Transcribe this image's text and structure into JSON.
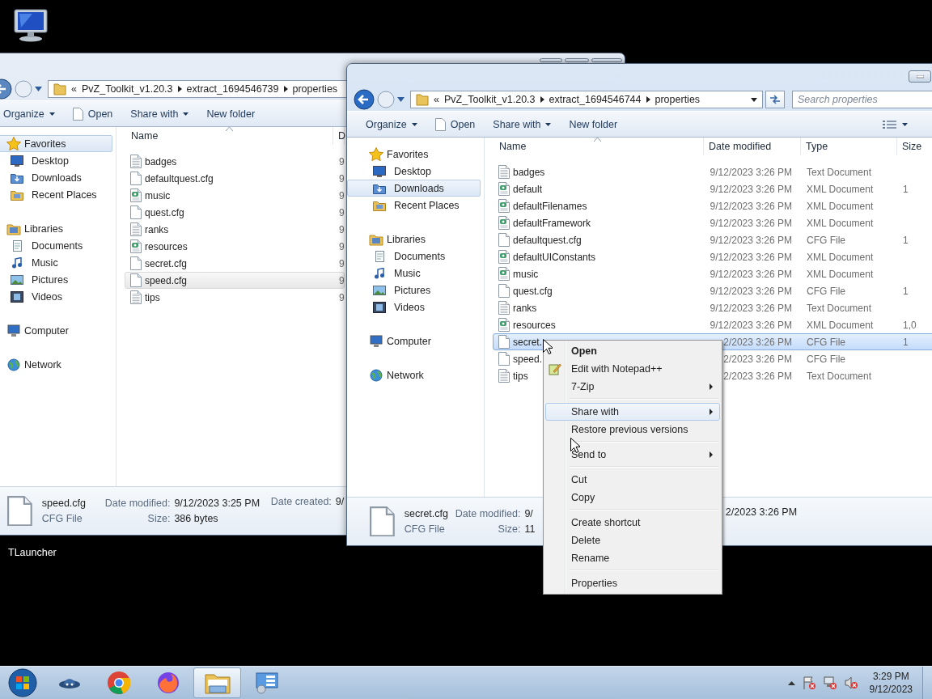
{
  "desktop_icons": [
    {
      "label": "TLauncher"
    }
  ],
  "windows": [
    {
      "active": false,
      "address": {
        "overflow": "«",
        "parts": [
          "PvZ_Toolkit_v1.20.3",
          "extract_1694546739",
          "properties"
        ]
      },
      "toolbar": [
        {
          "label": "Organize",
          "kind": "menu"
        },
        {
          "label": "Open",
          "kind": "open"
        },
        {
          "label": "Share with",
          "kind": "menu"
        },
        {
          "label": "New folder",
          "kind": "plain"
        }
      ],
      "nav": [
        {
          "label": "Favorites",
          "selected": true,
          "children": [
            {
              "label": "Desktop",
              "selected": false
            },
            {
              "label": "Downloads",
              "selected": false
            },
            {
              "label": "Recent Places",
              "selected": false
            }
          ]
        },
        {
          "label": "Libraries",
          "selected": false,
          "children": [
            {
              "label": "Documents",
              "selected": false
            },
            {
              "label": "Music",
              "selected": false
            },
            {
              "label": "Pictures",
              "selected": false
            },
            {
              "label": "Videos",
              "selected": false
            }
          ]
        },
        {
          "label": "Computer",
          "selected": false
        },
        {
          "label": "Network",
          "selected": false
        }
      ],
      "columns": [
        "Name",
        "D"
      ],
      "files": [
        {
          "name": "badges",
          "kind": "text",
          "date": "9",
          "selected": false
        },
        {
          "name": "defaultquest.cfg",
          "kind": "blank",
          "date": "9",
          "selected": false
        },
        {
          "name": "music",
          "kind": "xml",
          "date": "9",
          "selected": false
        },
        {
          "name": "quest.cfg",
          "kind": "blank",
          "date": "9",
          "selected": false
        },
        {
          "name": "ranks",
          "kind": "text",
          "date": "9",
          "selected": false
        },
        {
          "name": "resources",
          "kind": "xml",
          "date": "9",
          "selected": false
        },
        {
          "name": "secret.cfg",
          "kind": "blank",
          "date": "9",
          "selected": false
        },
        {
          "name": "speed.cfg",
          "kind": "blank",
          "date": "9",
          "selected": true
        },
        {
          "name": "tips",
          "kind": "text",
          "date": "9",
          "selected": false
        }
      ],
      "details": {
        "name": "speed.cfg",
        "type": "CFG File",
        "fields": [
          {
            "label": "Date modified:",
            "value": "9/12/2023 3:25 PM"
          },
          {
            "label": "Size:",
            "value": "386 bytes"
          },
          {
            "label": "Date created:",
            "value": "9/"
          }
        ]
      }
    },
    {
      "active": true,
      "address": {
        "overflow": "«",
        "parts": [
          "PvZ_Toolkit_v1.20.3",
          "extract_1694546744",
          "properties"
        ]
      },
      "search": {
        "placeholder": "Search properties"
      },
      "toolbar": [
        {
          "label": "Organize",
          "kind": "menu"
        },
        {
          "label": "Open",
          "kind": "open"
        },
        {
          "label": "Share with",
          "kind": "menu"
        },
        {
          "label": "New folder",
          "kind": "plain"
        }
      ],
      "nav": [
        {
          "label": "Favorites",
          "selected": false,
          "children": [
            {
              "label": "Desktop",
              "selected": false
            },
            {
              "label": "Downloads",
              "selected": true
            },
            {
              "label": "Recent Places",
              "selected": false
            }
          ]
        },
        {
          "label": "Libraries",
          "selected": false,
          "children": [
            {
              "label": "Documents",
              "selected": false
            },
            {
              "label": "Music",
              "selected": false
            },
            {
              "label": "Pictures",
              "selected": false
            },
            {
              "label": "Videos",
              "selected": false
            }
          ]
        },
        {
          "label": "Computer",
          "selected": false
        },
        {
          "label": "Network",
          "selected": false
        }
      ],
      "columns": [
        "Name",
        "Date modified",
        "Type",
        "Size"
      ],
      "files": [
        {
          "name": "badges",
          "kind": "text",
          "date": "9/12/2023 3:26 PM",
          "type": "Text Document",
          "selected": false
        },
        {
          "name": "default",
          "kind": "xml",
          "date": "9/12/2023 3:26 PM",
          "type": "XML Document",
          "size": "1",
          "selected": false
        },
        {
          "name": "defaultFilenames",
          "kind": "xml",
          "date": "9/12/2023 3:26 PM",
          "type": "XML Document",
          "selected": false
        },
        {
          "name": "defaultFramework",
          "kind": "xml",
          "date": "9/12/2023 3:26 PM",
          "type": "XML Document",
          "selected": false
        },
        {
          "name": "defaultquest.cfg",
          "kind": "blank",
          "date": "9/12/2023 3:26 PM",
          "type": "CFG File",
          "size": "1",
          "selected": false
        },
        {
          "name": "defaultUIConstants",
          "kind": "xml",
          "date": "9/12/2023 3:26 PM",
          "type": "XML Document",
          "selected": false
        },
        {
          "name": "music",
          "kind": "xml",
          "date": "9/12/2023 3:26 PM",
          "type": "XML Document",
          "selected": false
        },
        {
          "name": "quest.cfg",
          "kind": "blank",
          "date": "9/12/2023 3:26 PM",
          "type": "CFG File",
          "size": "1",
          "selected": false
        },
        {
          "name": "ranks",
          "kind": "text",
          "date": "9/12/2023 3:26 PM",
          "type": "Text Document",
          "selected": false
        },
        {
          "name": "resources",
          "kind": "xml",
          "date": "9/12/2023 3:26 PM",
          "type": "XML Document",
          "size": "1,0",
          "selected": false
        },
        {
          "name": "secret.",
          "kind": "blank",
          "date": "2/2023 3:26 PM",
          "type": "CFG File",
          "size": "1",
          "selected": true
        },
        {
          "name": "speed.",
          "kind": "blank",
          "date": "2/2023 3:26 PM",
          "type": "CFG File",
          "selected": false
        },
        {
          "name": "tips",
          "kind": "text",
          "date": "2/2023 3:26 PM",
          "type": "Text Document",
          "selected": false
        }
      ],
      "details": {
        "name": "secret.cfg",
        "type": "CFG File",
        "fields": [
          {
            "label": "Date modified:",
            "value": "9/"
          },
          {
            "label": "Size:",
            "value": "11"
          },
          {
            "value": "2/2023 3:26 PM"
          }
        ]
      }
    }
  ],
  "context_menu": {
    "groups": [
      [
        {
          "label": "Open",
          "kind": "default",
          "submenu": false,
          "selected": false
        },
        {
          "label": "Edit with Notepad++",
          "kind": "app",
          "submenu": false,
          "selected": false
        },
        {
          "label": "7-Zip",
          "kind": "plain",
          "submenu": true,
          "selected": false
        }
      ],
      [
        {
          "label": "Share with",
          "kind": "plain",
          "submenu": true,
          "selected": true
        },
        {
          "label": "Restore previous versions",
          "kind": "plain",
          "submenu": false,
          "selected": false
        }
      ],
      [
        {
          "label": "Send to",
          "kind": "plain",
          "submenu": true,
          "selected": false
        }
      ],
      [
        {
          "label": "Cut",
          "kind": "plain",
          "submenu": false,
          "selected": false
        },
        {
          "label": "Copy",
          "kind": "plain",
          "submenu": false,
          "selected": false
        }
      ],
      [
        {
          "label": "Create shortcut",
          "kind": "plain",
          "submenu": false,
          "selected": false
        },
        {
          "label": "Delete",
          "kind": "plain",
          "submenu": false,
          "selected": false
        },
        {
          "label": "Rename",
          "kind": "plain",
          "submenu": false,
          "selected": false
        }
      ],
      [
        {
          "label": "Properties",
          "kind": "plain",
          "submenu": false,
          "selected": false
        }
      ]
    ]
  },
  "taskbar": {
    "apps": [
      {
        "selected": false
      },
      {
        "selected": false
      },
      {
        "selected": false
      },
      {
        "selected": true
      },
      {
        "selected": false
      }
    ],
    "clock": {
      "time": "3:29 PM",
      "date": "9/12/2023"
    }
  }
}
